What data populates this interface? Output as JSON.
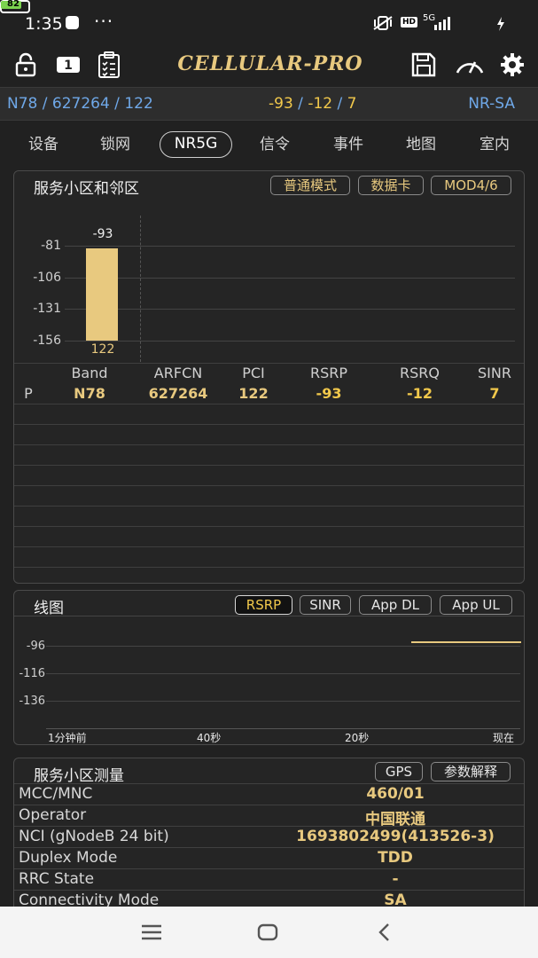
{
  "status_bar": {
    "time": "1:35",
    "more": "···",
    "hd": "HD",
    "network": "5G",
    "battery_level": 82,
    "battery_text": "82"
  },
  "toolbar": {
    "app_name": "CELLULAR-PRO"
  },
  "summary": {
    "cell_info": "N78 / 627264 / 122",
    "rsrp": "-93",
    "rsrq": "-12",
    "sinr": "7",
    "sep": " / ",
    "mode": "NR-SA"
  },
  "tabs": [
    {
      "label": "设备"
    },
    {
      "label": "锁网"
    },
    {
      "label": "NR5G",
      "active": true
    },
    {
      "label": "信令"
    },
    {
      "label": "事件"
    },
    {
      "label": "地图"
    },
    {
      "label": "室内"
    }
  ],
  "serving_panel": {
    "title": "服务小区和邻区",
    "buttons": [
      "普通模式",
      "数据卡",
      "MOD4/6"
    ],
    "chart_data": {
      "type": "bar",
      "categories": [
        "122"
      ],
      "values": [
        -93
      ],
      "value_labels": [
        "-93"
      ],
      "ylim": [
        -166,
        -66
      ],
      "yticks": [
        -81,
        -106,
        -131,
        -156
      ],
      "ytick_labels": [
        "-81",
        "-106",
        "-131",
        "-156"
      ],
      "bar_color": "#e8c97f",
      "grid": true
    },
    "table": {
      "headers": [
        "",
        "Band",
        "ARFCN",
        "PCI",
        "RSRP",
        "RSRQ",
        "SINR"
      ],
      "rows": [
        [
          "P",
          "N78",
          "627264",
          "122",
          "-93",
          "-12",
          "7"
        ]
      ]
    }
  },
  "line_panel": {
    "title": "线图",
    "buttons": [
      "RSRP",
      "SINR",
      "App DL",
      "App UL"
    ],
    "selected": "RSRP",
    "chart_data": {
      "type": "line",
      "series": [
        {
          "values": [
            -94,
            -94
          ]
        }
      ],
      "ytick_labels": [
        "-96",
        "-116",
        "-136"
      ],
      "yticks": [
        -96,
        -116,
        -136
      ],
      "xtick_labels": [
        "1分钟前",
        "40秒",
        "20秒",
        "现在"
      ],
      "line_color": "#e8c97f",
      "grid": true
    }
  },
  "measure_panel": {
    "title": "服务小区测量",
    "buttons": [
      "GPS",
      "参数解释"
    ],
    "rows": [
      {
        "label": "MCC/MNC",
        "value": "460/01"
      },
      {
        "label": "Operator",
        "value": "中国联通"
      },
      {
        "label": "NCI (gNodeB 24 bit)",
        "value": "1693802499(413526-3)"
      },
      {
        "label": "Duplex Mode",
        "value": "TDD"
      },
      {
        "label": "RRC State",
        "value": "-"
      },
      {
        "label": "Connectivity Mode",
        "value": "SA"
      }
    ]
  },
  "colors": {
    "accent": "#e8c97f",
    "highlight": "#f1c84b",
    "blue": "#6fa8e8",
    "background": "#212121"
  }
}
